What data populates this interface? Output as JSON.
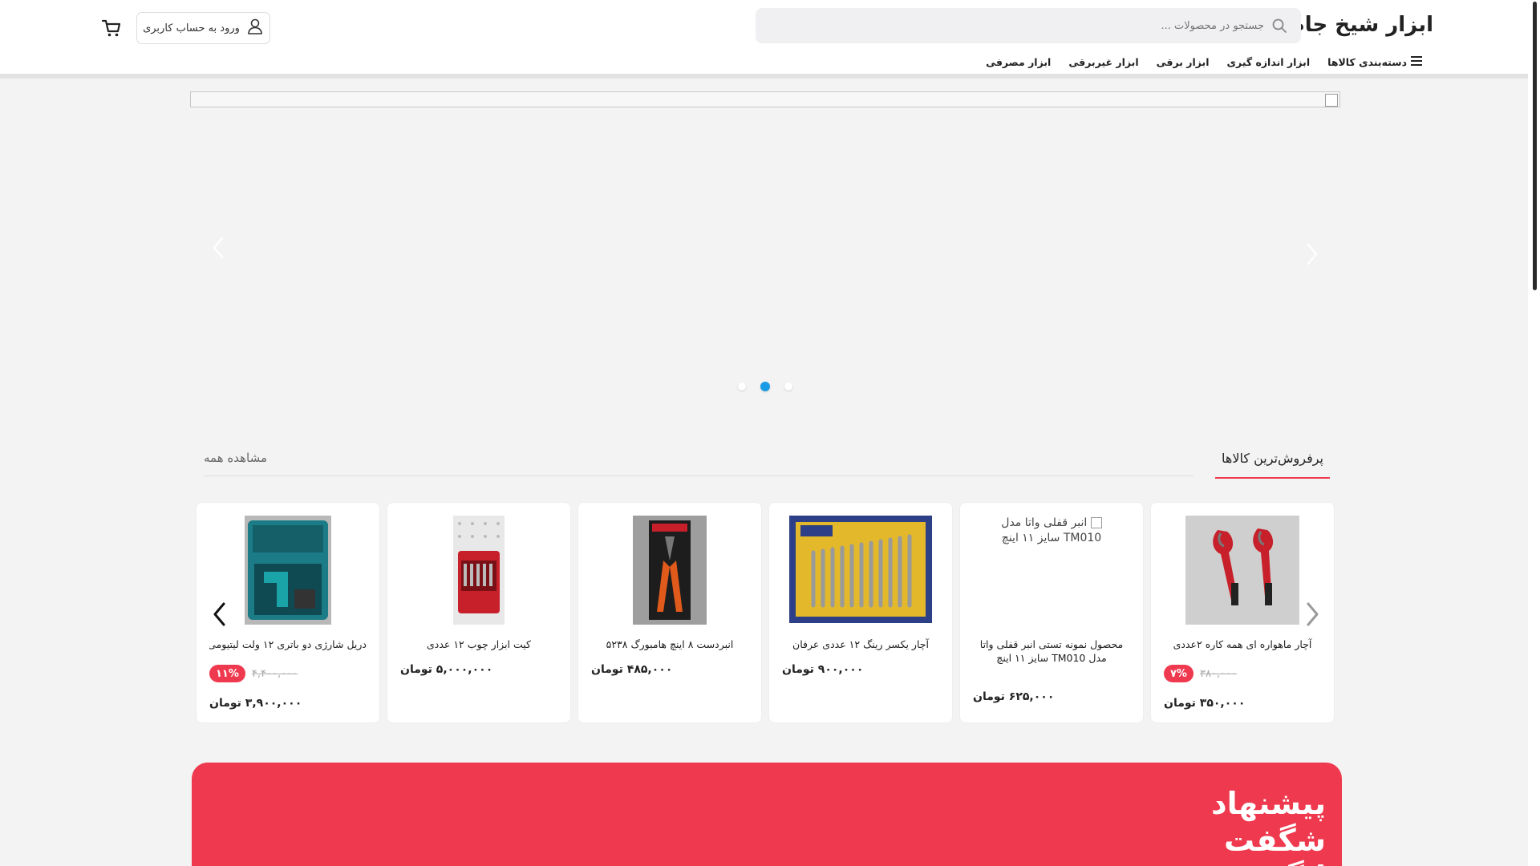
{
  "header": {
    "logo": "ابزار شیخ جام",
    "search_placeholder": "جستجو در محصولات ...",
    "login_label": "ورود به حساب کاربری",
    "nav": [
      {
        "label": "دسته‌بندی کالاها"
      },
      {
        "label": "ابزار اندازه گیری"
      },
      {
        "label": "ابزار برقی"
      },
      {
        "label": "ابزار غیربرقی"
      },
      {
        "label": "ابزار مصرفی"
      }
    ]
  },
  "slider": {
    "dots": 3,
    "active_dot": 1
  },
  "best_sellers": {
    "title": "پرفروش‌ترین کالاها",
    "view_all": "مشاهده همه",
    "products": [
      {
        "name": "آچار ماهواره ای همه کاره ۲عددی",
        "old_price": "۳۸۰,۰۰۰",
        "discount": "۷%",
        "price": "۳۵۰,۰۰۰ تومان"
      },
      {
        "name": "محصول نمونه تستی انبر قفلی واتا مدل TM010 سایز ۱۱ اینچ",
        "image_alt": "انبر قفلی واتا مدل TM010 سایز ۱۱ اینچ",
        "price": "۶۲۵,۰۰۰ تومان"
      },
      {
        "name": "آچار یکسر رینگ ۱۲ عددی عرفان",
        "price": "۹۰۰,۰۰۰ تومان"
      },
      {
        "name": "انبردست ۸ اینچ هامبورگ ۵۲۳۸",
        "price": "۴۸۵,۰۰۰ تومان"
      },
      {
        "name": "کیت ابزار چوب ۱۲ عددی",
        "price": "۵,۰۰۰,۰۰۰ تومان"
      },
      {
        "name": "دریل شارژی دو باتری ۱۲ ولت لیتیومی",
        "old_price": "۴,۴۰۰,۰۰۰",
        "discount": "۱۱%",
        "price": "۳,۹۰۰,۰۰۰ تومان"
      }
    ]
  },
  "special_offer": {
    "title": "پیشنهاد شگفت انگیز"
  },
  "colors": {
    "accent": "#ef394e",
    "active_dot": "#1a9be6"
  }
}
